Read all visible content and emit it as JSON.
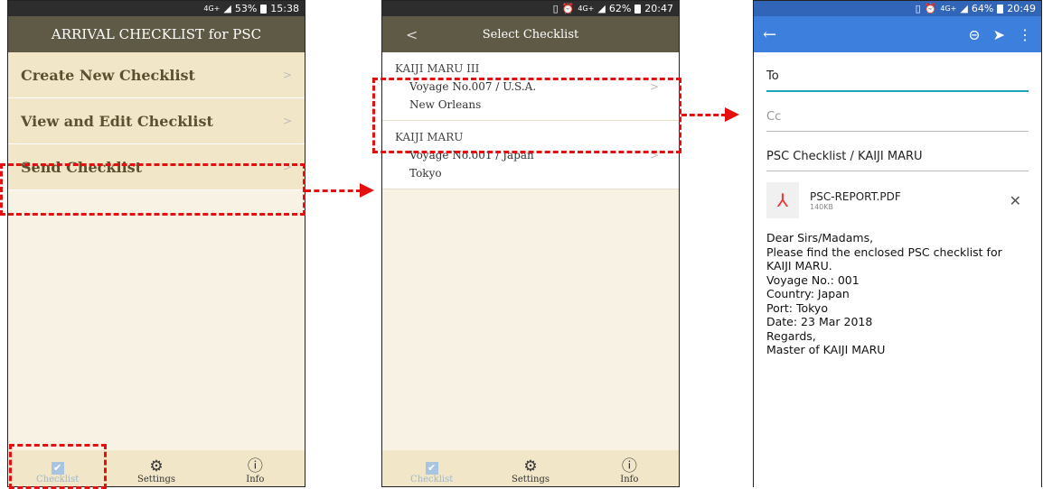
{
  "screen1": {
    "status": {
      "network": "4G+",
      "battery": "53%",
      "time": "15:38"
    },
    "title": "ARRIVAL CHECKLIST for PSC",
    "menu": [
      {
        "label": "Create New Checklist",
        "chevron": ">"
      },
      {
        "label": "View and Edit Checklist",
        "chevron": ">"
      },
      {
        "label": "Send Checklist",
        "chevron": ">"
      }
    ],
    "tabs": [
      {
        "label": "Checklist",
        "icon": "checkbox-icon"
      },
      {
        "label": "Settings",
        "icon": "gear-icon"
      },
      {
        "label": "Info",
        "icon": "info-icon"
      }
    ]
  },
  "screen2": {
    "status": {
      "network": "4G+",
      "battery": "62%",
      "time": "20:47"
    },
    "back": "<",
    "title": "Select Checklist",
    "ships": [
      {
        "name": "KAIJI MARU III",
        "voyage": "Voyage No.007 / U.S.A.",
        "port": "New Orleans",
        "chevron": ">"
      },
      {
        "name": "KAIJI MARU",
        "voyage": "Voyage No.001 / Japan",
        "port": "Tokyo",
        "chevron": ">"
      }
    ],
    "tabs": [
      {
        "label": "Checklist"
      },
      {
        "label": "Settings"
      },
      {
        "label": "Info"
      }
    ]
  },
  "screen3": {
    "status": {
      "network": "4G+",
      "battery": "64%",
      "time": "20:49"
    },
    "to": "To",
    "cc": "Cc",
    "subject": "PSC Checklist / KAIJI MARU",
    "attachment": {
      "name": "PSC-REPORT.PDF",
      "size": "140KB"
    },
    "body": [
      "Dear Sirs/Madams,",
      "Please find the enclosed PSC checklist for",
      "KAIJI MARU.",
      "Voyage No.: 001",
      "Country: Japan",
      "Port: Tokyo",
      "Date: 23 Mar 2018",
      "Regards,",
      "Master of KAIJI MARU"
    ]
  },
  "colors": {
    "highlight": "#e41010",
    "header": "#5f5a45",
    "mail_bar": "#3d7fdd"
  }
}
